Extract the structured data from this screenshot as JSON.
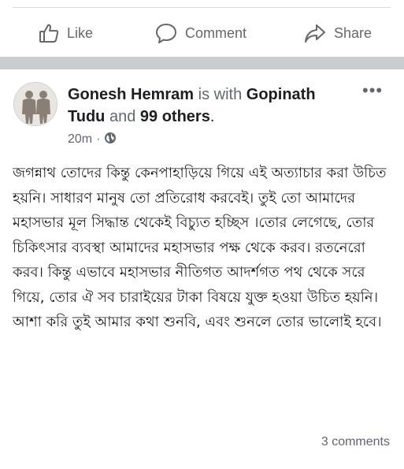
{
  "actions": {
    "like_label": "Like",
    "comment_label": "Comment",
    "share_label": "Share"
  },
  "post": {
    "author": "Gonesh Hemram",
    "with_text": "is with",
    "tagged": "Gopinath Tudu",
    "and_text": "and",
    "others": "99 others",
    "period": ".",
    "time": "20m",
    "separator": "·",
    "privacy_icon": "globe-icon",
    "body": "জগন্নাথ তোদের কিন্তু কেনপাহাড়িয়ে গিয়ে এই অত্যাচার করা উচিত হয়নি। সাধারণ মানুষ তো প্রতিরোধ করবেই। তুই তো আমাদের মহাসভার মূল সিদ্ধান্ত থেকেই বিচ্যুত হচ্ছিস ।তোর লেগেছে, তোর চিকিৎসার ব্যবস্থা আমাদের মহাসভার পক্ষ থেকে করব। রতনেরো করব। কিন্তু এভাবে মহাসভার নীতিগত আদর্শগত পথ থেকে সরে গিয়ে, তোর ঐ সব চারাইয়ের টাকা বিষয়ে যুক্ত হওয়া উচিত হয়নি। আশা করি তুই আমার কথা শুনবি, এবং শুনলে তোর ভালোই হবে।",
    "comments_count": "3 comments"
  },
  "colors": {
    "text": "#1c1e21",
    "muted": "#606770",
    "divider": "#c9ccd1"
  }
}
